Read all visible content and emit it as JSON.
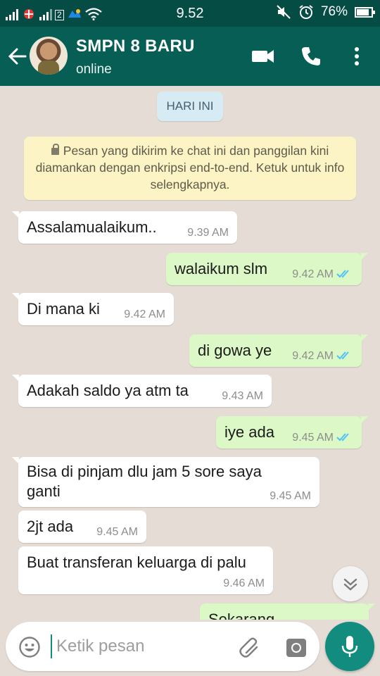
{
  "status_bar": {
    "time": "9.52",
    "battery": "76%",
    "carrier_small": "2"
  },
  "header": {
    "title": "SMPN 8 BARU",
    "subtitle": "online"
  },
  "chat": {
    "date_chip": "HARI INI",
    "encryption_notice": "Pesan yang dikirim ke chat ini dan panggilan kini diamankan dengan enkripsi end-to-end. Ketuk untuk info selengkapnya.",
    "messages": [
      {
        "direction": "in",
        "text": "Assalamualaikum..",
        "time": "9.39 AM"
      },
      {
        "direction": "out",
        "text": "walaikum slm",
        "time": "9.42 AM",
        "status": "read"
      },
      {
        "direction": "in",
        "text": "Di mana ki",
        "time": "9.42 AM"
      },
      {
        "direction": "out",
        "text": "di gowa ye",
        "time": "9.42 AM",
        "status": "read"
      },
      {
        "direction": "in",
        "text": "Adakah saldo ya atm ta",
        "time": "9.43 AM"
      },
      {
        "direction": "out",
        "text": "iye ada",
        "time": "9.45 AM",
        "status": "read"
      },
      {
        "direction": "in",
        "text": "Bisa di pinjam dlu jam 5 sore saya ganti",
        "time": "9.45 AM"
      },
      {
        "direction": "in",
        "text": "2jt ada",
        "time": "9.45 AM"
      },
      {
        "direction": "in",
        "text": "Buat transferan keluarga di palu",
        "time": "9.46 AM"
      },
      {
        "direction": "out",
        "text": "Sekarang",
        "time": ""
      }
    ]
  },
  "composer": {
    "placeholder": "Ketik pesan"
  },
  "colors": {
    "status_bar": "#054d44",
    "header": "#075e54",
    "accent": "#128c7e",
    "chat_background": "#e5ddd5",
    "incoming_bubble": "#ffffff",
    "outgoing_bubble": "#dcf8c6",
    "read_ticks": "#4fc3f7"
  },
  "icons": {
    "back": "arrow-left-icon",
    "video_call": "video-camera-icon",
    "voice_call": "phone-icon",
    "menu": "more-vertical-icon",
    "scroll_down": "double-chevron-down-icon",
    "emoji": "smiley-icon",
    "attach": "paperclip-icon",
    "camera": "camera-icon",
    "mic": "microphone-icon"
  }
}
